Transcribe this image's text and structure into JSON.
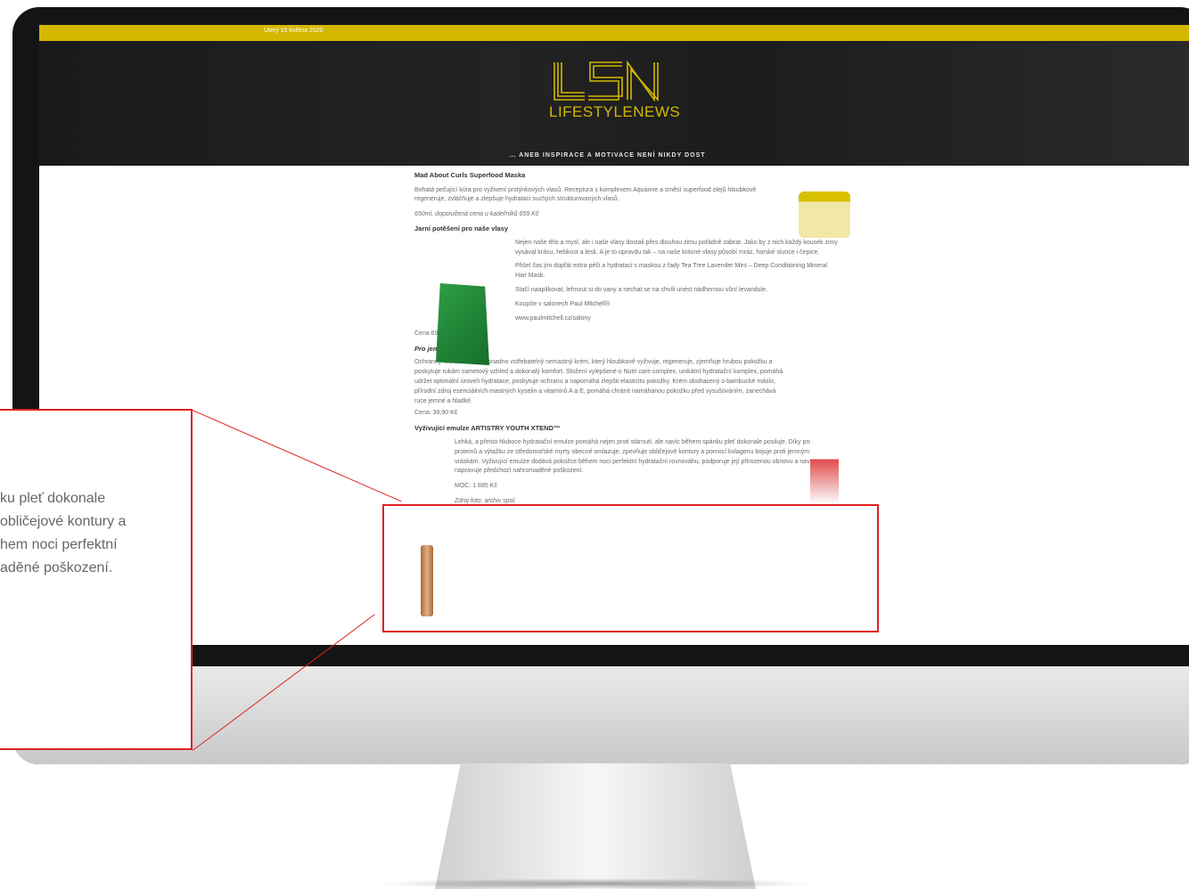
{
  "site": {
    "date": "Úterý 15 května 2020",
    "logo_text": "LSN",
    "logo_name": "LIFESTYLENEWS",
    "tagline": "… ANEB INSPIRACE A MOTIVACE NENÍ NIKDY DOST"
  },
  "articles": [
    {
      "title": "Mad About Curls Superfood Maska",
      "body": "Bohatá pečující kúra pro vyživení prstýnkových vlasů. Receptura s komplexem Aquanne a směsí superfood olejů hloubkově regeneruje, zvláčňuje a zlepšuje hydrataci suchých strukturovaných vlasů.",
      "note": "650ml, doporučená cena u kadeřníků 659 Kč"
    },
    {
      "title": "Jarní potěšení pro naše vlasy",
      "body1": "Nejen naše tělo a mysl, ale i naše vlasy dostali přes dlouhou zimu pořádně zabrat. Jako by z nich každý kousek zimy vysával krásu, hebkost a lesk. A je to opravdu tak – na naše krásné vlasy působí mráz, horské slunce i čepice.",
      "body2": "Přišel čas jim dopřát extra péči a hydrataci s maskou z řady Tea Tree Lavender Mint – Deep Conditioning Mineral Hair Mask.",
      "body3": "Stačí naaplikovat, lehnout si do vany a nechat se na chvíli unést nádhernou vůní levandule.",
      "body4": "Koupíte v salonech Paul Mitchell®",
      "link": "www.paulmitchell.cz/salony",
      "price": "Cena 695 Kč / 25,27 €"
    },
    {
      "title": "Pro jemné pohlazení",
      "body": "Ochranný krém na ruce je snadno vstřebatelný nemastný krém, který hloubkově vyživuje, regeneruje, zjemňuje hrubou pokožku a poskytuje rukám sametový vzhled a dokonalý komfort. Složení vylepšené o Nutri care complex, unikátní hydratační komplex, pomáhá udržet optimální úroveň hydratace, poskytuje ochranu a napomáhá zlepšit elasticitu pokožky. Krém obohacený o bambucké máslo, přírodní zdroj esenciálních mastných kyselin a vitamínů A a E, pomáhá chránit namáhanou pokožku před vysušováním, zanechává ruce jemné a hladké.",
      "price": "Cena: 39,90 Kč"
    },
    {
      "title": "Vyživující emulze ARTISTRY YOUTH XTEND™",
      "body": "Lehká, a přesto hluboce hydratační emulze pomáhá nejen proti stárnutí, ale navíc během spánku pleť dokonale posiluje. Díky produkci proteinů a výtažku ze středomořské myrty obecné omlazuje, zpevňuje obličejové kontury a pomocí kolagenu bojuje proti jemným linkám i vráskám. Vyživující emulze dodává pokožce během noci perfektní hydratační rovnováhu, podporuje její přirozenou obnovu a navíc napravuje předchozí nahromaděné poškození.",
      "price": "MOC: 1 885 Kč",
      "source": "Zdroj foto: archiv spol."
    }
  ],
  "callout": {
    "lines": [
      "ku pleť dokonale",
      "obličejové kontury a",
      "hem noci perfektní",
      "aděné poškození."
    ]
  },
  "colors": {
    "accent": "#d4b800",
    "highlight": "#e02020"
  }
}
